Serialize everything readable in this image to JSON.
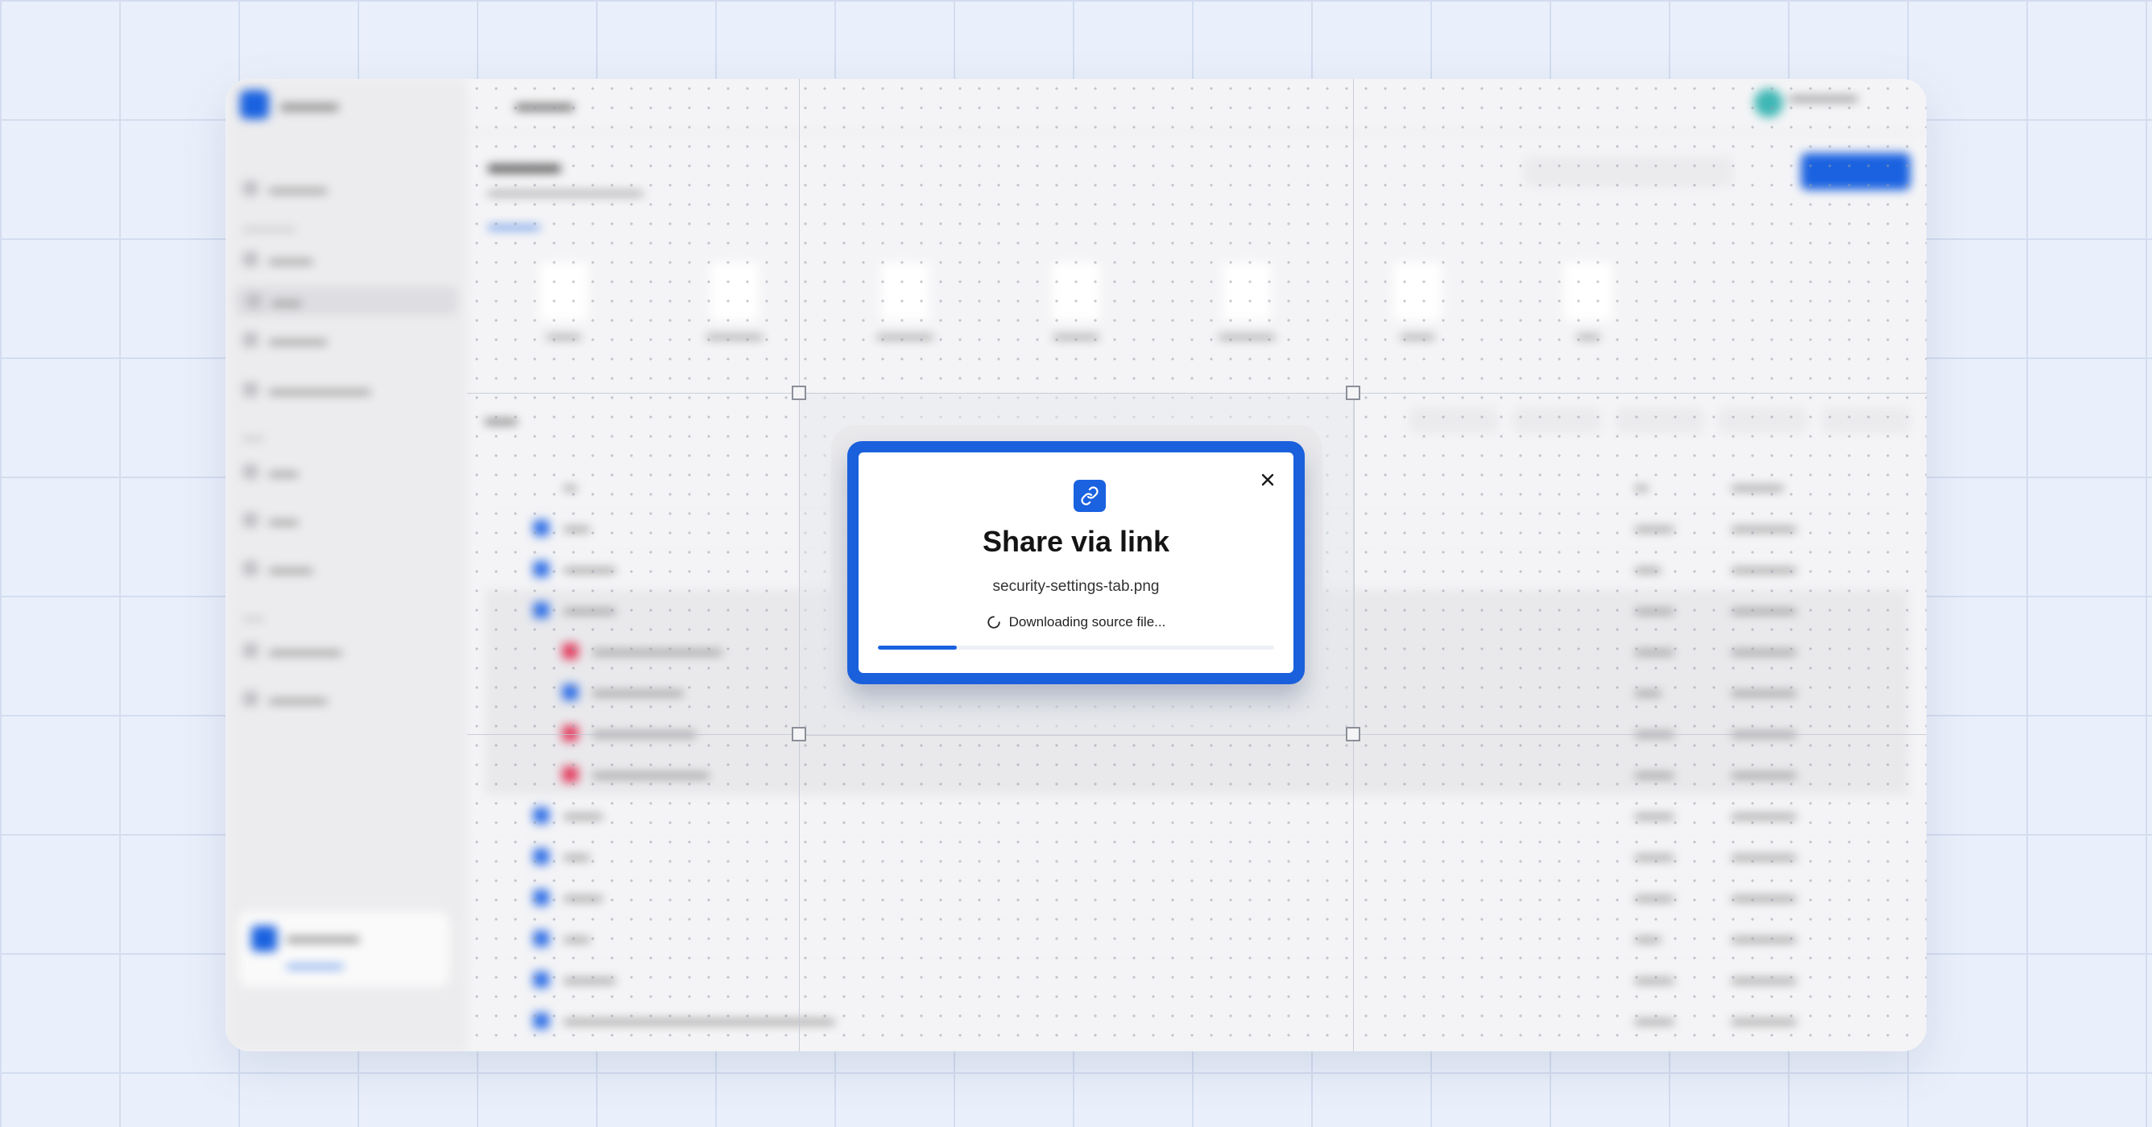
{
  "background": {
    "grid_color": "#d3ddef",
    "canvas_color": "#eaf0fb"
  },
  "dialog": {
    "icon": "link-icon",
    "title": "Share via link",
    "file_name": "security-settings-tab.png",
    "status": "Downloading source file...",
    "progress": 0.2,
    "accent_color": "#1a62e0",
    "close_icon": "close-icon"
  }
}
